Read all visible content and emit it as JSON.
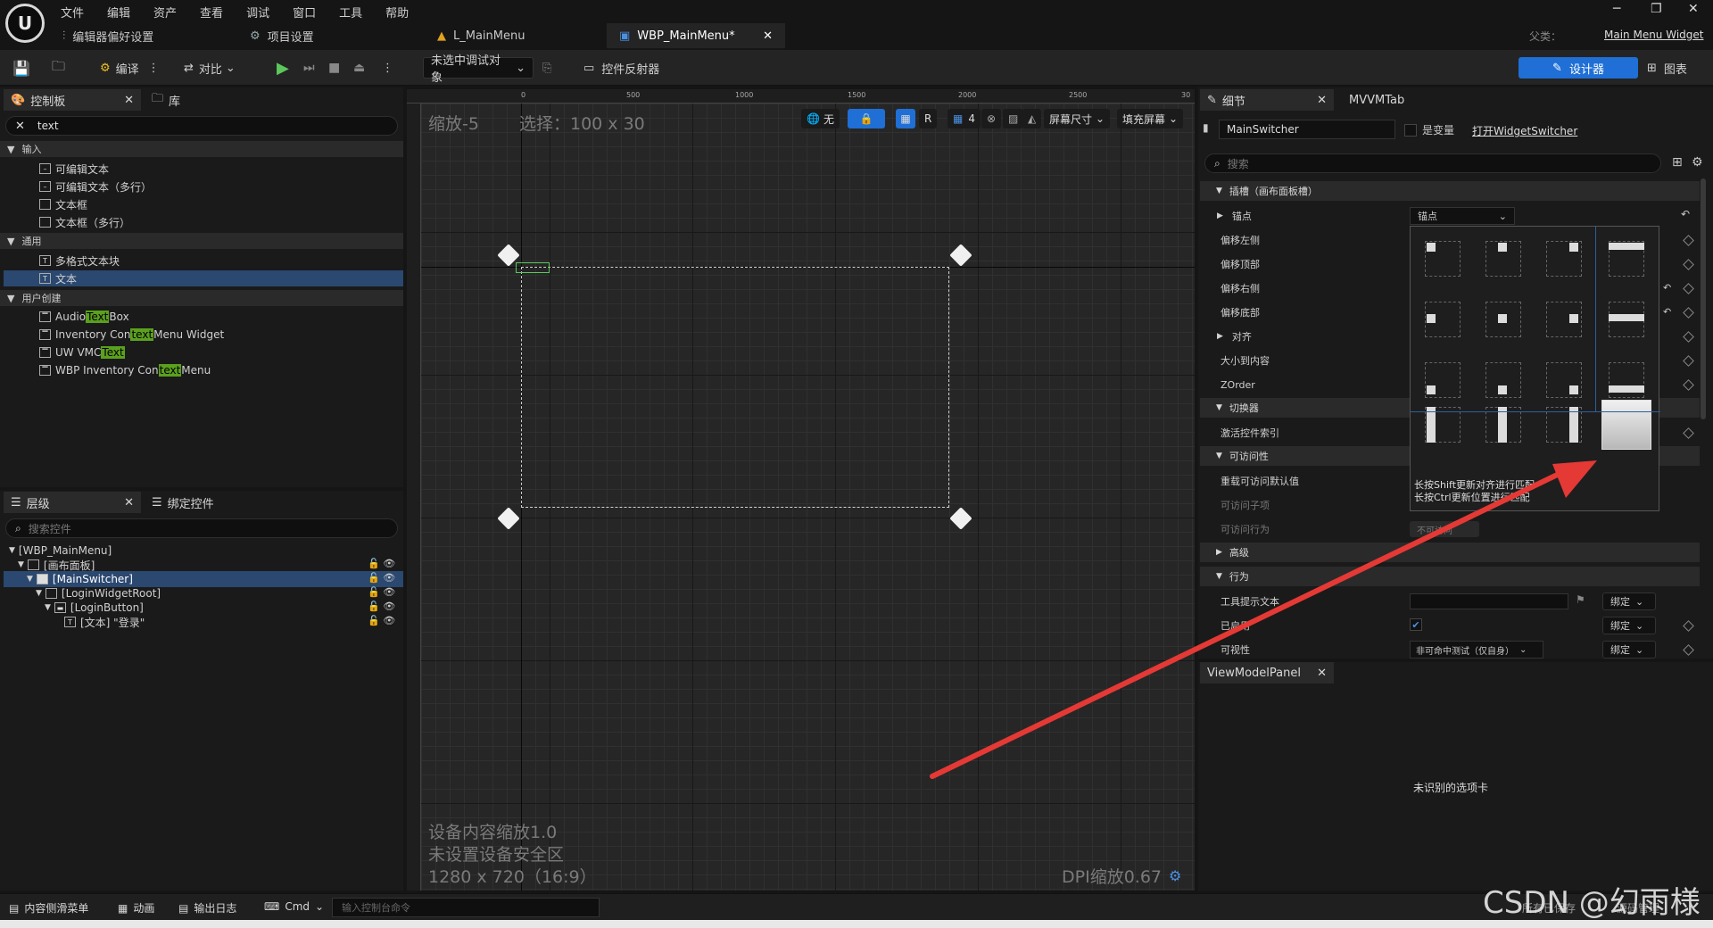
{
  "menubar": {
    "items": [
      "文件",
      "编辑",
      "资产",
      "查看",
      "调试",
      "窗口",
      "工具",
      "帮助"
    ],
    "logo_text": "U"
  },
  "tabs": {
    "editor_prefs": "编辑器偏好设置",
    "project_settings": "项目设置",
    "level_tab": "L_MainMenu",
    "widget_tab": "WBP_MainMenu*",
    "parent_label": "父类：",
    "parent_value": "Main Menu Widget"
  },
  "toolbar": {
    "compile": "编译",
    "diff": "对比",
    "debug_target": "未选中调试对象",
    "widget_reflector": "控件反射器",
    "designer": "设计器",
    "graph": "图表"
  },
  "palette": {
    "tab_palette": "控制板",
    "tab_library": "库",
    "search_value": "text",
    "cat_input": "输入",
    "input_items": [
      "可编辑文本",
      "可编辑文本（多行）",
      "文本框",
      "文本框（多行）"
    ],
    "cat_common": "通用",
    "common_items": [
      "多格式文本块",
      "文本"
    ],
    "cat_user": "用户创建",
    "user_items": [
      {
        "pre": "Audio ",
        "hl": "Text",
        "post": " Box"
      },
      {
        "pre": "Inventory Con",
        "hl": "text",
        "post": " Menu Widget"
      },
      {
        "pre": "UW VMC",
        "hl": "Text",
        "post": ""
      },
      {
        "pre": "WBP Inventory Con",
        "hl": "text",
        "post": " Menu"
      }
    ]
  },
  "hierarchy": {
    "tab_hierarchy": "层级",
    "tab_bind": "绑定控件",
    "search_placeholder": "搜索控件",
    "nodes": [
      "[WBP_MainMenu]",
      "[画布面板]",
      "[MainSwitcher]",
      "[LoginWidgetRoot]",
      "[LoginButton]",
      "[文本] \"登录\""
    ]
  },
  "viewport": {
    "zoom": "缩放-5",
    "selection": "选择：100 x 30",
    "ruler_labels": [
      "0",
      "500",
      "1000",
      "1500",
      "2000",
      "2500",
      "30"
    ],
    "none_label": "无",
    "r_label": "R",
    "grid_num": "4",
    "screen_size": "屏幕尺寸",
    "fill_screen": "填充屏幕",
    "device_scale": "设备内容缩放1.0",
    "no_safe_zone": "未设置设备安全区",
    "resolution": "1280 x 720（16:9）",
    "dpi": "DPI缩放0.67"
  },
  "details": {
    "tab_details": "细节",
    "tab_mvvm": "MVVMTab",
    "widget_name": "MainSwitcher",
    "is_variable": "是变量",
    "open_link": "打开WidgetSwitcher",
    "search_placeholder": "搜索",
    "cat_slot": "插槽（画布面板槽）",
    "anchor_label": "锚点",
    "anchor_value": "锚点",
    "offsets": [
      "偏移左侧",
      "偏移顶部",
      "偏移右侧",
      "偏移底部"
    ],
    "align": "对齐",
    "size_to_content": "大小到内容",
    "zorder": "ZOrder",
    "cat_switcher": "切换器",
    "active_index": "激活控件索引",
    "cat_access": "可访问性",
    "override_access": "重载可访问默认值",
    "access_children": "可访问子项",
    "access_behavior": "可访问行为",
    "access_value": "不可访问",
    "cat_advanced": "高级",
    "cat_behavior": "行为",
    "tooltip": "工具提示文本",
    "enabled": "已启用",
    "visibility": "可视性",
    "visibility_value": "非可命中测试（仅自身）",
    "bind": "绑定",
    "tip_line1": "长按Shift更新对齐进行匹配",
    "tip_line2": "长按Ctrl更新位置进行匹配"
  },
  "viewmodel": {
    "tab": "ViewModelPanel",
    "message": "未识别的选项卡"
  },
  "bottombar": {
    "content_drawer": "内容侧滑菜单",
    "animation": "动画",
    "output_log": "输出日志",
    "cmd": "Cmd",
    "cmd_placeholder": "输入控制台命令",
    "save_status": "所有已保存",
    "source_control": "源码管理"
  },
  "watermark": "CSDN @幻雨様",
  "colors": {
    "accent": "#1f6fd6",
    "highlight": "#5ba01e",
    "arrow": "#e53935"
  }
}
